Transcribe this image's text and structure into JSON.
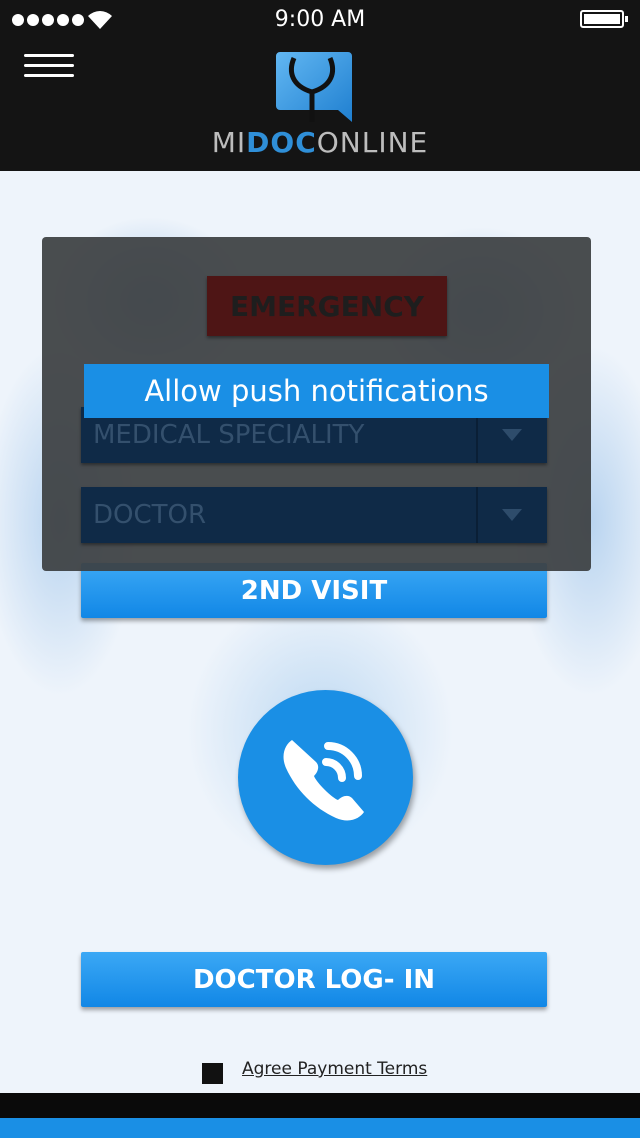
{
  "status_bar": {
    "time": "9:00 AM"
  },
  "header": {
    "brand_prefix": "MI",
    "brand_highlight": "DOC",
    "brand_suffix": "ONLINE"
  },
  "modal": {
    "emergency_label": "EMERGENCY",
    "push_notification_label": "Allow push notifications",
    "specialty_select": "MEDICAL SPECIALITY",
    "doctor_select": "DOCTOR"
  },
  "main": {
    "second_visit_label": "2ND VISIT",
    "call_icon": "phone-call-icon",
    "doctor_login_label": "DOCTOR LOG- IN",
    "agree_terms_label": "Agree  Payment Terms"
  },
  "colors": {
    "accent": "#1a8fe5",
    "header_bg": "#141414",
    "emergency": "#4e1515"
  }
}
